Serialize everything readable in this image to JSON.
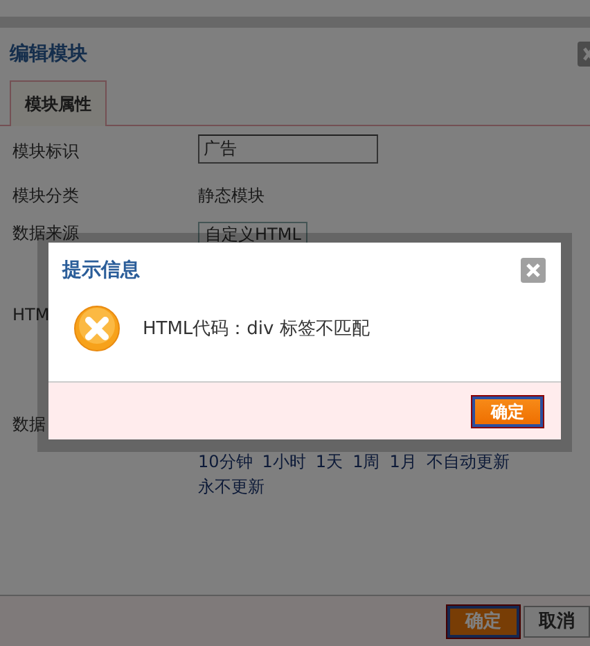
{
  "dialog": {
    "title": "编辑模块",
    "tabs": [
      {
        "label": "模块属性",
        "selected": true
      }
    ],
    "fields": [
      {
        "label": "模块标识",
        "kind": "input",
        "value": "广告"
      },
      {
        "label": "模块分类",
        "kind": "text",
        "value": "静态模块"
      },
      {
        "label": "数据来源",
        "kind": "select",
        "value": "自定义HTML"
      },
      {
        "label": "HTM",
        "kind": "blank"
      },
      {
        "label": "数据",
        "kind": "blank"
      }
    ],
    "refresh_links": [
      "10分钟",
      "1小时",
      "1天",
      "1周",
      "1月",
      "不自动更新",
      "永不更新"
    ],
    "buttons": [
      {
        "label": "确定",
        "kind": "primary"
      },
      {
        "label": "取消",
        "kind": "secondary"
      }
    ]
  },
  "alert": {
    "title": "提示信息",
    "message": "HTML代码：div 标签不匹配",
    "buttons": [
      {
        "label": "确定"
      }
    ]
  }
}
